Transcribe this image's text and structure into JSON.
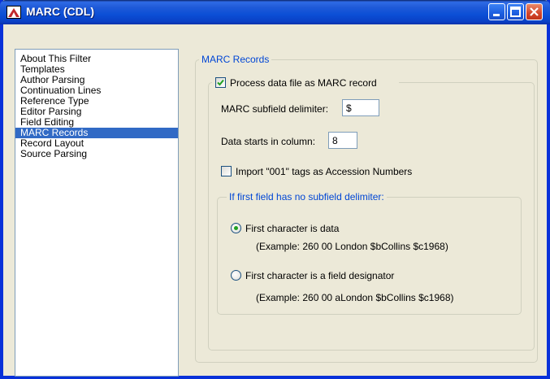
{
  "window": {
    "title": "MARC (CDL)"
  },
  "sidebar": {
    "items": [
      {
        "label": "About This Filter"
      },
      {
        "label": "Templates"
      },
      {
        "label": "Author Parsing"
      },
      {
        "label": "Continuation Lines"
      },
      {
        "label": "Reference Type"
      },
      {
        "label": "Editor Parsing"
      },
      {
        "label": "Field Editing"
      },
      {
        "label": "MARC Records",
        "selected": true
      },
      {
        "label": "Record Layout"
      },
      {
        "label": "Source Parsing"
      }
    ]
  },
  "marc_group": {
    "title": "MARC Records",
    "process_checkbox": {
      "label": "Process data file as MARC record",
      "checked": true
    },
    "subfield_delimiter": {
      "label": "MARC subfield delimiter:",
      "value": "$"
    },
    "data_column": {
      "label": "Data starts in column:",
      "value": "8"
    },
    "import_001": {
      "label": "Import \"001\" tags as Accession Numbers",
      "checked": false
    },
    "no_delimiter_group": {
      "title": "If first field has no subfield delimiter:",
      "option_data": {
        "label": "First character is data",
        "example": "(Example: 260 00 London $bCollins $c1968)",
        "selected": true
      },
      "option_designator": {
        "label": "First character is a field designator",
        "example": "(Example: 260 00 aLondon $bCollins $c1968)",
        "selected": false
      }
    }
  },
  "colors": {
    "titlebar": "#0b4fd6",
    "selection": "#316ac5",
    "group_title": "#0046d5",
    "check_green": "#21a121"
  }
}
